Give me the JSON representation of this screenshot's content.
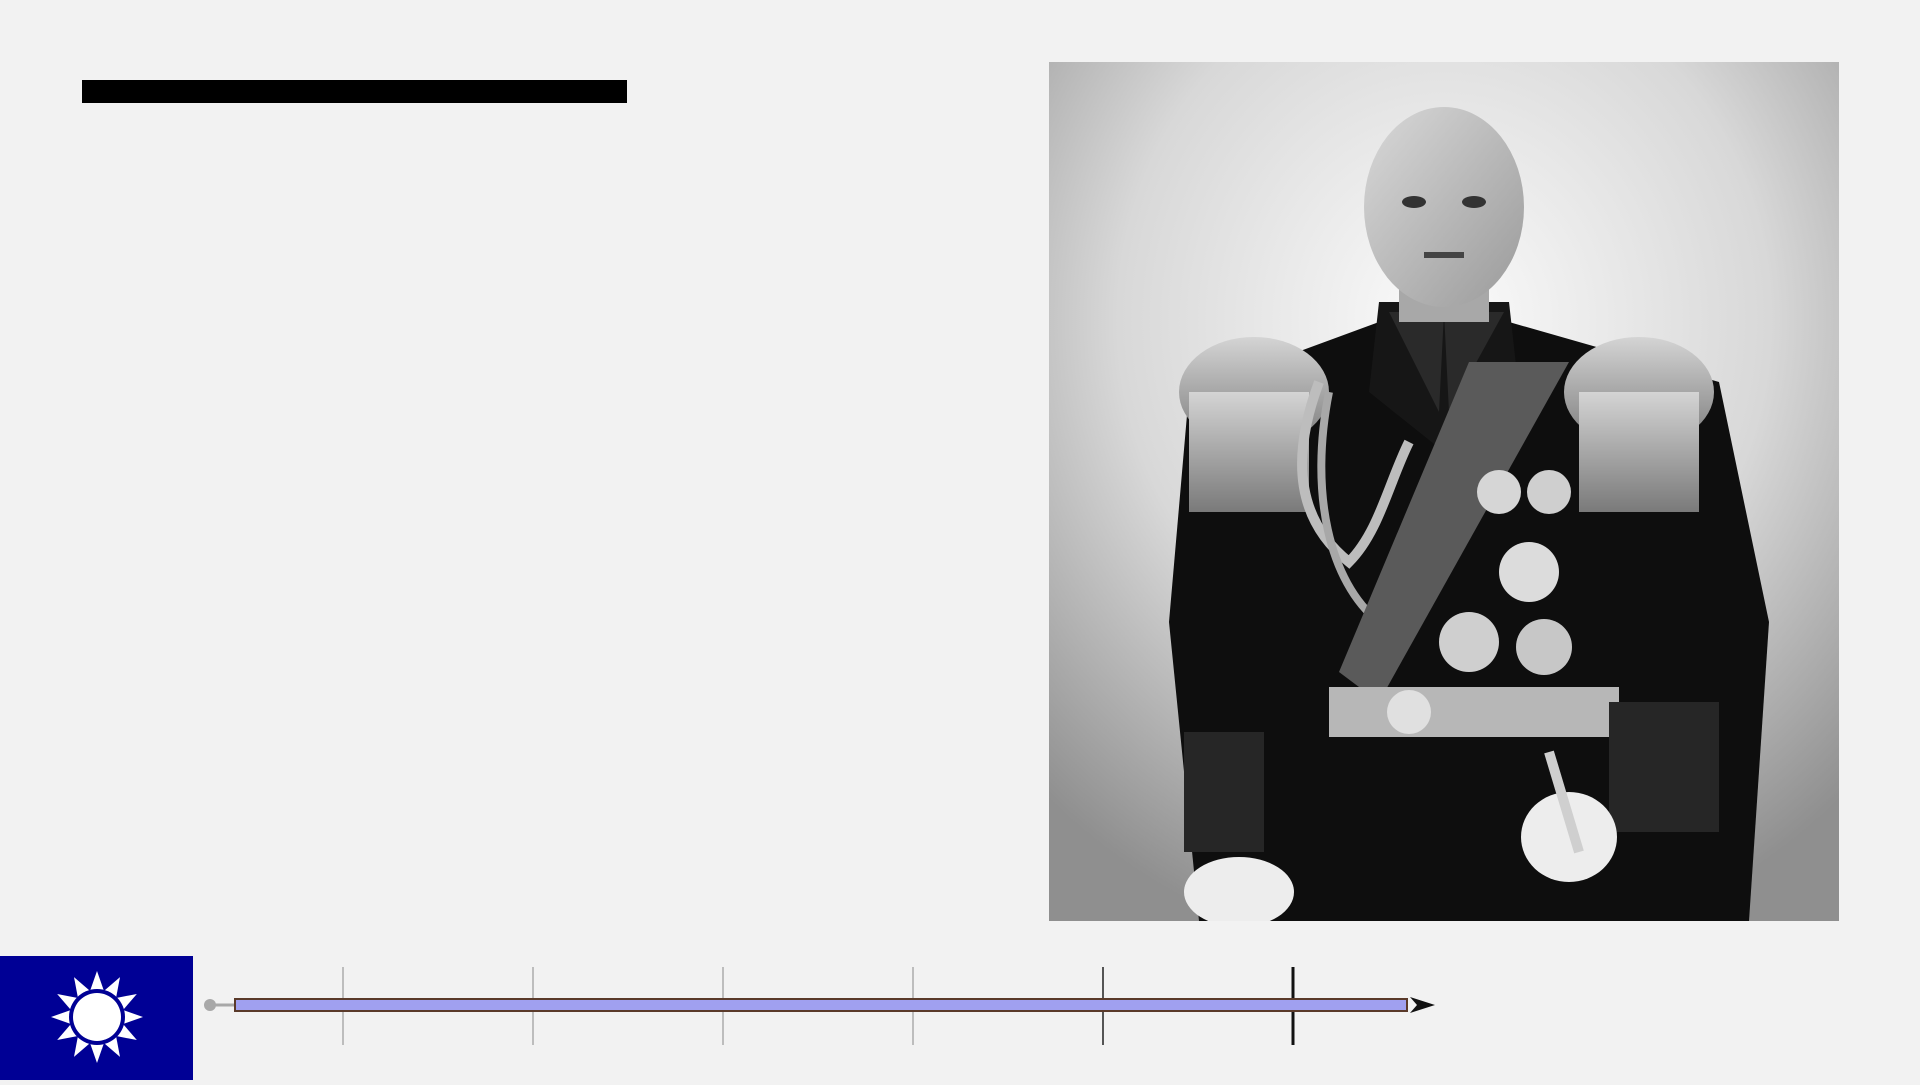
{
  "slide": {
    "title_bar_color": "#000000",
    "background_color": "#f2f2f2"
  },
  "portrait": {
    "kind": "black-and-white formal military portrait"
  },
  "flag_badge": {
    "background_color": "#000095",
    "emblem_color": "#ffffff",
    "emblem": "twelve-ray-sun-icon"
  },
  "timeline": {
    "bar_color": "#a0a0f0",
    "tick_count": 6,
    "active_tick_index": 5,
    "arrow_icon": "arrow-right-icon"
  }
}
